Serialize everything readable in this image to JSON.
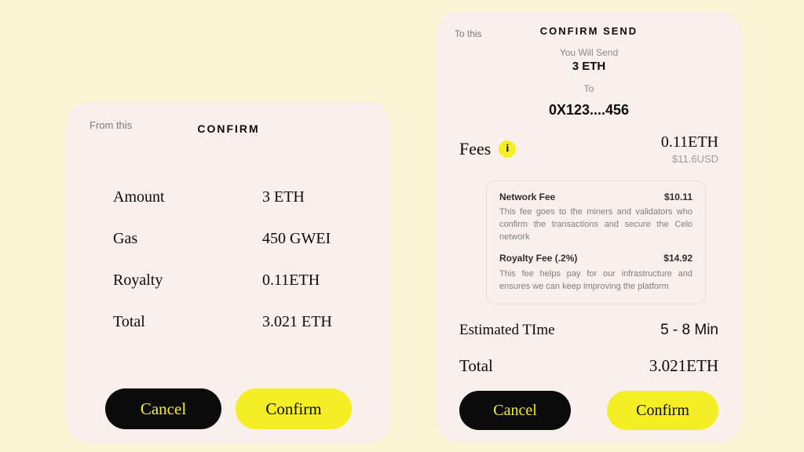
{
  "left": {
    "corner_label": "From this",
    "title": "CONFIRM",
    "rows": {
      "amount": {
        "label": "Amount",
        "value": "3 ETH"
      },
      "gas": {
        "label": "Gas",
        "value": "450 GWEI"
      },
      "royalty": {
        "label": "Royalty",
        "value": "0.11ETH"
      },
      "total": {
        "label": "Total",
        "value": "3.021 ETH"
      }
    },
    "buttons": {
      "cancel": "Cancel",
      "confirm": "Confirm"
    }
  },
  "right": {
    "corner_label": "To this",
    "title": "CONFIRM SEND",
    "you_will_send_label": "You Will Send",
    "amount": "3 ETH",
    "to_label": "To",
    "address": "0X123....456",
    "fees": {
      "label": "Fees",
      "info_glyph": "i",
      "value_eth": "0.11ETH",
      "value_usd": "$11.6USD",
      "breakdown": {
        "network": {
          "name": "Network Fee",
          "amount": "$10.11",
          "description": "This fee goes to the miners and validators who confirm the transactions and secure the Celo network"
        },
        "royalty": {
          "name": "Royalty Fee (.2%)",
          "amount": "$14.92",
          "description": "This fee helps pay for our infrastructure and ensures we can keep improving the platform"
        }
      }
    },
    "estimated_time": {
      "label": "Estimated TIme",
      "value": "5 - 8 Min"
    },
    "total": {
      "label": "Total",
      "value": "3.021ETH"
    },
    "buttons": {
      "cancel": "Cancel",
      "confirm": "Confirm"
    }
  }
}
